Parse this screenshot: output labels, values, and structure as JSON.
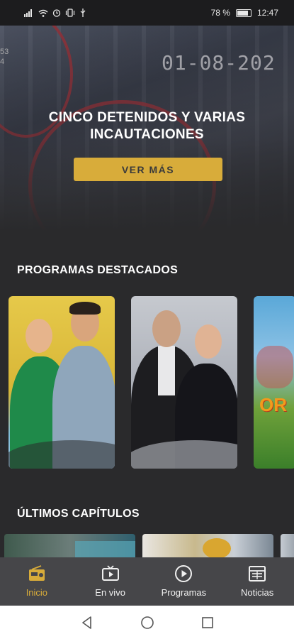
{
  "status_bar": {
    "battery": "78 %",
    "time": "12:47"
  },
  "hero": {
    "headline_line1": "CINCO DETENIDOS Y VARIAS",
    "headline_line2": "INCAUTACIONES",
    "button_label": "VER MÁS",
    "cam_date": "01-08-202",
    "cam_numbers": [
      "53",
      "4"
    ]
  },
  "sections": {
    "featured_title": "PROGRAMAS DESTACADOS",
    "chapters_title": "ÚLTIMOS CAPÍTULOS"
  },
  "featured_programs": [
    {
      "icon": "program-card-hosts-green"
    },
    {
      "icon": "program-card-hosts-black"
    },
    {
      "icon": "program-card-game-show",
      "logo_text": "OR"
    }
  ],
  "bottom_nav": [
    {
      "label": "Inicio",
      "icon": "radio-icon",
      "active": true
    },
    {
      "label": "En vivo",
      "icon": "tv-icon",
      "active": false
    },
    {
      "label": "Programas",
      "icon": "play-circle-icon",
      "active": false
    },
    {
      "label": "Noticias",
      "icon": "newspaper-icon",
      "active": false
    }
  ],
  "colors": {
    "accent": "#d8ac3a",
    "background": "#2a2a2c",
    "nav_background": "#464649"
  }
}
